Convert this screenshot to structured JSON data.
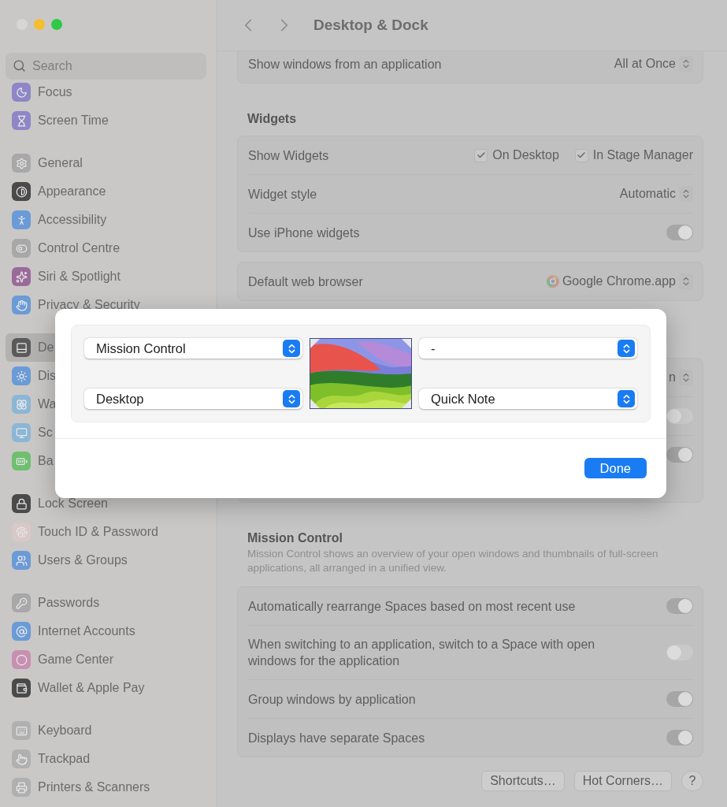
{
  "window": {
    "title": "Desktop & Dock"
  },
  "search": {
    "placeholder": "Search"
  },
  "sidebar": {
    "groups": [
      {
        "items": [
          {
            "label": "Focus",
            "selected": false
          },
          {
            "label": "Screen Time",
            "selected": false
          }
        ]
      },
      {
        "items": [
          {
            "label": "General",
            "selected": false
          },
          {
            "label": "Appearance",
            "selected": false
          },
          {
            "label": "Accessibility",
            "selected": false
          },
          {
            "label": "Control Centre",
            "selected": false
          },
          {
            "label": "Siri & Spotlight",
            "selected": false
          },
          {
            "label": "Privacy & Security",
            "selected": false
          }
        ]
      },
      {
        "items": [
          {
            "label": "De",
            "selected": true
          },
          {
            "label": "Dis",
            "selected": false
          },
          {
            "label": "Wa",
            "selected": false
          },
          {
            "label": "Sc",
            "selected": false
          },
          {
            "label": "Ba",
            "selected": false
          }
        ]
      },
      {
        "items": [
          {
            "label": "Lock Screen",
            "selected": false
          },
          {
            "label": "Touch ID & Password",
            "selected": false
          },
          {
            "label": "Users & Groups",
            "selected": false
          }
        ]
      },
      {
        "items": [
          {
            "label": "Passwords",
            "selected": false
          },
          {
            "label": "Internet Accounts",
            "selected": false
          },
          {
            "label": "Game Center",
            "selected": false
          },
          {
            "label": "Wallet & Apple Pay",
            "selected": false
          }
        ]
      },
      {
        "items": [
          {
            "label": "Keyboard",
            "selected": false
          },
          {
            "label": "Trackpad",
            "selected": false
          },
          {
            "label": "Printers & Scanners",
            "selected": false
          }
        ]
      }
    ]
  },
  "sections": [
    {
      "rows": [
        {
          "kind": "popup",
          "label": "Show windows from an application",
          "value": "All at Once"
        }
      ]
    },
    {
      "heading": "Widgets",
      "rows": [
        {
          "kind": "checks",
          "label": "Show Widgets",
          "options": [
            {
              "label": "On Desktop",
              "checked": true
            },
            {
              "label": "In Stage Manager",
              "checked": true
            }
          ]
        },
        {
          "kind": "popup",
          "label": "Widget style",
          "value": "Automatic"
        },
        {
          "kind": "toggle",
          "label": "Use iPhone widgets",
          "on": true
        }
      ]
    },
    {
      "rows": [
        {
          "kind": "browser",
          "label": "Default web browser",
          "value": "Google Chrome.app"
        }
      ]
    },
    {
      "rows": [
        {
          "kind": "popup",
          "value": "n"
        },
        {
          "kind": "toggle",
          "on": false
        },
        {
          "kind": "toggle",
          "on": true
        }
      ]
    },
    {
      "heading": "Mission Control",
      "description": "Mission Control shows an overview of your open windows and thumbnails of full-screen applications, all arranged in a unified view.",
      "rows": [
        {
          "kind": "toggle",
          "label": "Automatically rearrange Spaces based on most recent use",
          "on": true
        },
        {
          "kind": "toggle",
          "label": "When switching to an application, switch to a Space with open windows for the application",
          "on": false
        },
        {
          "kind": "toggle",
          "label": "Group windows by application",
          "on": true
        },
        {
          "kind": "toggle",
          "label": "Displays have separate Spaces",
          "on": true
        }
      ]
    }
  ],
  "footer_buttons": [
    {
      "label": "Shortcuts…"
    },
    {
      "label": "Hot Corners…"
    },
    {
      "label": "?"
    }
  ],
  "dialog": {
    "corners": [
      {
        "value": "Mission Control"
      },
      {
        "value": "-"
      },
      {
        "value": "Desktop"
      },
      {
        "value": "Quick Note"
      }
    ],
    "button": "Done"
  }
}
